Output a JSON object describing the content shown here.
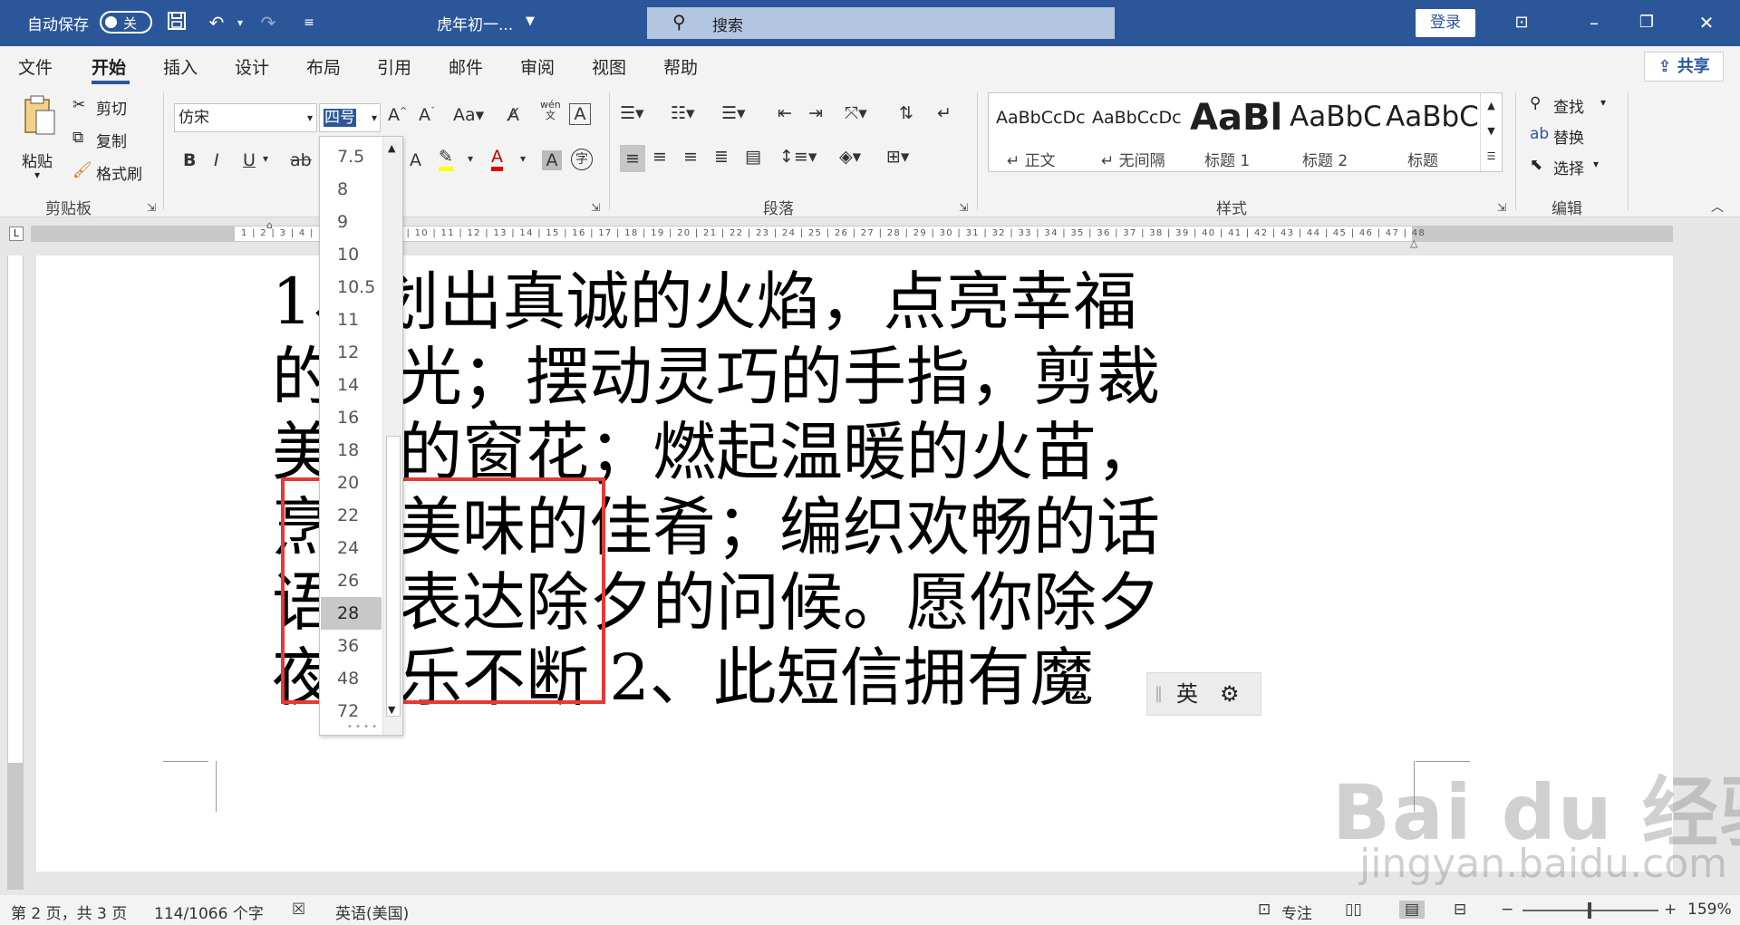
{
  "titlebar": {
    "autosave_label": "自动保存",
    "autosave_state": "关",
    "doc_title": "虎年初一...",
    "search_placeholder": "搜索",
    "login_label": "登录",
    "bg_color": "#2b579a"
  },
  "tabs": [
    "文件",
    "开始",
    "插入",
    "设计",
    "布局",
    "引用",
    "邮件",
    "审阅",
    "视图",
    "帮助"
  ],
  "active_tab": "开始",
  "share_label": "共享",
  "clipboard": {
    "paste": "粘贴",
    "cut": "剪切",
    "copy": "复制",
    "format_painter": "格式刷",
    "group_label": "剪贴板"
  },
  "font": {
    "font_name": "仿宋",
    "font_size": "四号",
    "phonetic_top": "wén",
    "phonetic_bottom": "文"
  },
  "paragraph": {
    "group_label": "段落"
  },
  "styles": {
    "group_label": "样式",
    "items": [
      {
        "preview": "AaBbCcDc",
        "name": "正文",
        "prefix": "↵"
      },
      {
        "preview": "AaBbCcDc",
        "name": "无间隔",
        "prefix": "↵"
      },
      {
        "preview": "AaBl",
        "name": "标题 1"
      },
      {
        "preview": "AaBbC",
        "name": "标题 2"
      },
      {
        "preview": "AaBbC",
        "name": "标题"
      }
    ]
  },
  "editing": {
    "find": "查找",
    "replace": "替换",
    "select": "选择",
    "group_label": "编辑"
  },
  "font_size_dropdown": {
    "items": [
      "7.5",
      "8",
      "9",
      "10",
      "10.5",
      "11",
      "12",
      "14",
      "16",
      "18",
      "20",
      "22",
      "24",
      "26",
      "28",
      "36",
      "48",
      "72"
    ],
    "selected": "28"
  },
  "ruler_numbers": "1 | 2 | 3 | 4 | 5 | 6 | 7 | 8 | 9 | 10 | 11 | 12 | 13 | 14 | 15 | 16 | 17 | 18 | 19 | 20 | 21 | 22 | 23 | 24 | 25 | 26 | 27 | 28 | 29 | 30 | 31 | 32 | 33 | 34 | 35 | 36 | 37 | 38 | 39 | 40 | 41 | 42 | 43 | 44 | 45 | 46 | 47 | 48",
  "document": {
    "lines": [
      "1、划出真诚的火焰，点亮幸福",
      "的烛光；摆动灵巧的手指，剪裁",
      "美丽的窗花；燃起温暖的火苗，",
      "烹饪美味的佳肴；编织欢畅的话",
      "语，表达除夕的问候。愿你除夕",
      "夜快乐不断 2、此短信拥有魔"
    ]
  },
  "ime": {
    "label": "英"
  },
  "statusbar": {
    "page": "第 2 页，共 3 页",
    "words": "114/1066 个字",
    "language": "英语(美国)",
    "focus": "专注",
    "zoom": "159%"
  },
  "watermark": {
    "line1": "Bai du 经验",
    "line2": "jingyan.baidu.com"
  },
  "colors": {
    "accent": "#2b579a",
    "highlight_box": "#e53935"
  }
}
